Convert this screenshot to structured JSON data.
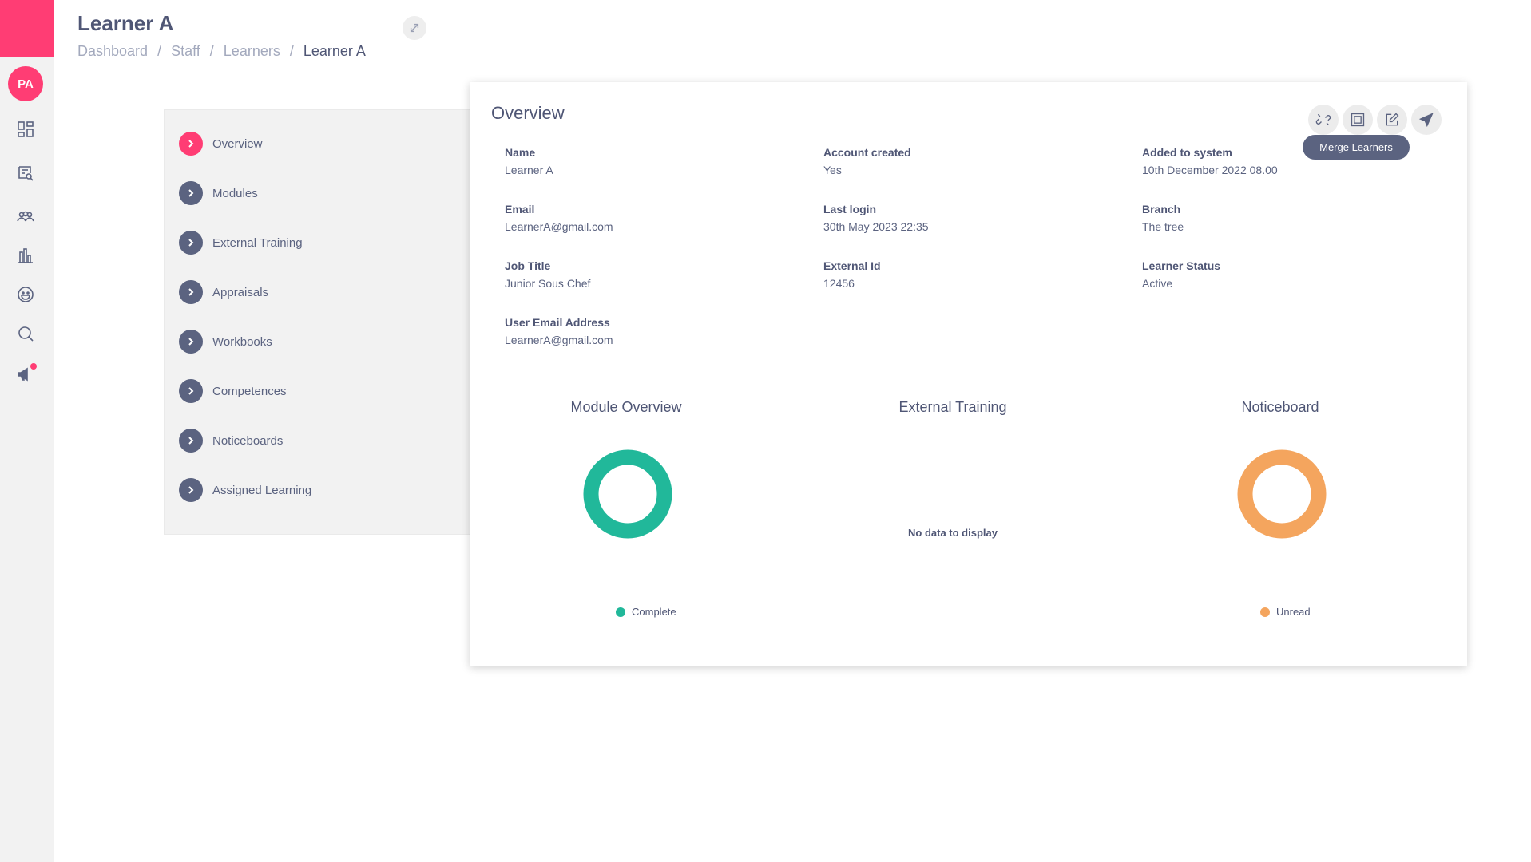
{
  "rail": {
    "avatar_initials": "PA",
    "brand_color": "#ff3d74",
    "icons": [
      "dashboard-icon",
      "search-document-icon",
      "users-icon",
      "bar-chart-icon",
      "smiley-icon",
      "search-icon",
      "megaphone-icon"
    ]
  },
  "header": {
    "title": "Learner A",
    "breadcrumbs": [
      "Dashboard",
      "Staff",
      "Learners",
      "Learner A"
    ]
  },
  "menu": {
    "items": [
      "Overview",
      "Modules",
      "External Training",
      "Appraisals",
      "Workbooks",
      "Competences",
      "Noticeboards",
      "Assigned Learning"
    ],
    "active_index": 0
  },
  "overview": {
    "title": "Overview",
    "tooltip": "Merge Learners",
    "action_icons": [
      "merge-icon",
      "frame-icon",
      "edit-icon",
      "send-icon"
    ],
    "fields": {
      "name": {
        "label": "Name",
        "value": "Learner A"
      },
      "account_created": {
        "label": "Account created",
        "value": "Yes"
      },
      "added_to_system": {
        "label": "Added to system",
        "value": "10th December 2022 08.00"
      },
      "email": {
        "label": "Email",
        "value": "LearnerA@gmail.com"
      },
      "last_login": {
        "label": "Last login",
        "value": "30th May 2023 22:35"
      },
      "branch": {
        "label": "Branch",
        "value": "The tree"
      },
      "job_title": {
        "label": "Job Title",
        "value": "Junior Sous Chef"
      },
      "external_id": {
        "label": "External Id",
        "value": "12456"
      },
      "learner_status": {
        "label": "Learner Status",
        "value": "Active"
      },
      "user_email": {
        "label": "User Email Address",
        "value": "LearnerA@gmail.com"
      }
    }
  },
  "charts": {
    "module_overview": {
      "title": "Module Overview",
      "legend": "Complete",
      "color": "#21b89a"
    },
    "external_training": {
      "title": "External Training",
      "empty_text": "No data to display"
    },
    "noticeboard": {
      "title": "Noticeboard",
      "legend": "Unread",
      "color": "#f4a55e"
    }
  }
}
